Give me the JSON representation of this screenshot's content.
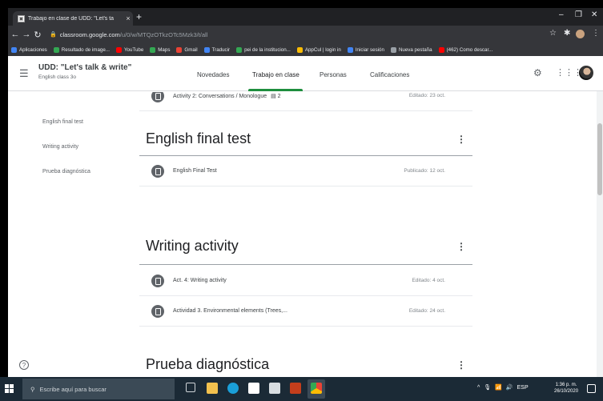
{
  "browser": {
    "tab_title": "Trabajo en clase de UDD: \"Let's ta",
    "tab_close": "×",
    "new_tab": "+",
    "url_host": "classroom.google.com",
    "url_path": "/u/0/w/MTQzOTkzOTc5Mzk3/t/all",
    "bookmarks": [
      {
        "label": "Aplicaciones",
        "color": "#4285f4"
      },
      {
        "label": "Resultado de image...",
        "color": "#34a853"
      },
      {
        "label": "YouTube",
        "color": "#ff0000"
      },
      {
        "label": "Maps",
        "color": "#34a853"
      },
      {
        "label": "Gmail",
        "color": "#ea4335"
      },
      {
        "label": "Traducir",
        "color": "#4285f4"
      },
      {
        "label": "pei de la institucion...",
        "color": "#34a853"
      },
      {
        "label": "AppCul | login in",
        "color": "#fbbc04"
      },
      {
        "label": "Iniciar sesión",
        "color": "#4285f4"
      },
      {
        "label": "Nueva pestaña",
        "color": "#9aa0a6"
      },
      {
        "label": "(462) Como descar...",
        "color": "#ff0000"
      }
    ]
  },
  "header": {
    "course_title": "UDD: \"Let's talk & write\"",
    "course_subtitle": "English class 3o",
    "tabs": [
      {
        "label": "Novedades"
      },
      {
        "label": "Trabajo en clase"
      },
      {
        "label": "Personas"
      },
      {
        "label": "Calificaciones"
      }
    ]
  },
  "sidebar": {
    "items": [
      {
        "label": "English final test"
      },
      {
        "label": "Writing activity"
      },
      {
        "label": "Prueba diagnóstica"
      }
    ]
  },
  "stream": {
    "top_item": {
      "title": "Activity 2: Conversations / Monologue",
      "badge": "2",
      "status": "Editado: 23 oct."
    },
    "topics": [
      {
        "title": "English final test",
        "items": [
          {
            "title": "English Final Test",
            "status": "Publicado: 12 oct."
          }
        ]
      },
      {
        "title": "Writing activity",
        "items": [
          {
            "title": "Act. 4: Writing activity",
            "status": "Editado: 4 oct."
          },
          {
            "title": "Actividad 3. Environmental elements (Trees,...",
            "status": "Editado: 24 oct."
          }
        ]
      },
      {
        "title": "Prueba diagnóstica",
        "items": []
      }
    ],
    "menu_glyph": "⋮"
  },
  "taskbar": {
    "search_placeholder": "Escribe aquí para buscar",
    "language": "ESP",
    "time": "1:36 p. m.",
    "date": "26/10/2020"
  }
}
